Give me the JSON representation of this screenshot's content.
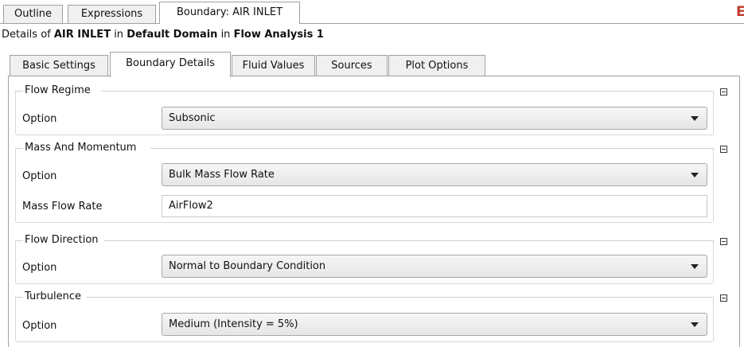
{
  "top_tabs": [
    "Outline",
    "Expressions",
    "Boundary: AIR INLET"
  ],
  "details": {
    "prefix": "Details of ",
    "boundary": "AIR INLET",
    "in1": " in ",
    "domain": "Default Domain",
    "in2": " in ",
    "analysis": "Flow Analysis 1"
  },
  "sub_tabs": [
    "Basic Settings",
    "Boundary Details",
    "Fluid Values",
    "Sources",
    "Plot Options"
  ],
  "groups": {
    "flow_regime": {
      "title": "Flow Regime",
      "option_label": "Option",
      "option_value": "Subsonic"
    },
    "mass_momentum": {
      "title": "Mass And Momentum",
      "option_label": "Option",
      "option_value": "Bulk Mass Flow Rate",
      "rate_label": "Mass Flow Rate",
      "rate_value": "AirFlow2"
    },
    "flow_direction": {
      "title": "Flow Direction",
      "option_label": "Option",
      "option_value": "Normal to Boundary Condition"
    },
    "turbulence": {
      "title": "Turbulence",
      "option_label": "Option",
      "option_value": "Medium (Intensity = 5%)"
    }
  },
  "close_glyph": "E",
  "colors": {
    "close_red": "#c0392b",
    "border": "#a0a0a0"
  }
}
